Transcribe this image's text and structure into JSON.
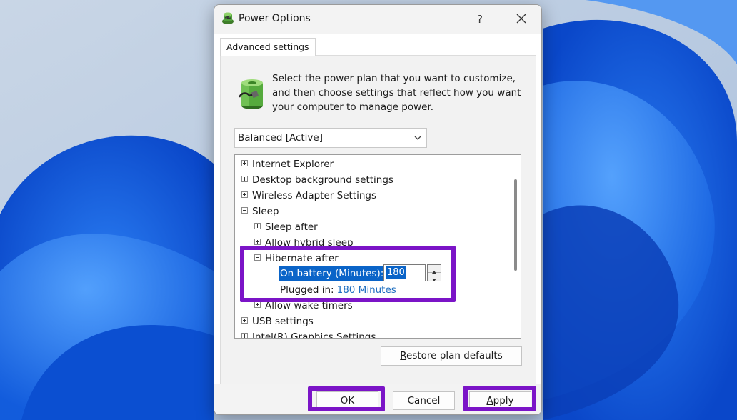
{
  "window": {
    "title": "Power Options",
    "help_label": "?",
    "tab_label": "Advanced settings"
  },
  "intro_text": "Select the power plan that you want to customize, and then choose settings that reflect how you want your computer to manage power.",
  "plan_select": {
    "value": "Balanced [Active]"
  },
  "tree": {
    "internet_explorer": "Internet Explorer",
    "desktop_background": "Desktop background settings",
    "wireless_adapter": "Wireless Adapter Settings",
    "sleep": "Sleep",
    "sleep_after": "Sleep after",
    "allow_hybrid_sleep": "Allow hybrid sleep",
    "hibernate_after": "Hibernate after",
    "on_battery_label": "On battery (Minutes):",
    "on_battery_value": "180",
    "plugged_in_label": "Plugged in:",
    "plugged_in_value": "180 Minutes",
    "allow_wake_timers": "Allow wake timers",
    "usb_settings": "USB settings",
    "intel_graphics": "Intel(R) Graphics Settings"
  },
  "buttons": {
    "restore_defaults": "Restore plan defaults",
    "ok": "OK",
    "cancel": "Cancel",
    "apply": "Apply"
  },
  "colors": {
    "highlight": "#7b14c7",
    "selection": "#0a64c8",
    "link": "#1f6fc0"
  }
}
